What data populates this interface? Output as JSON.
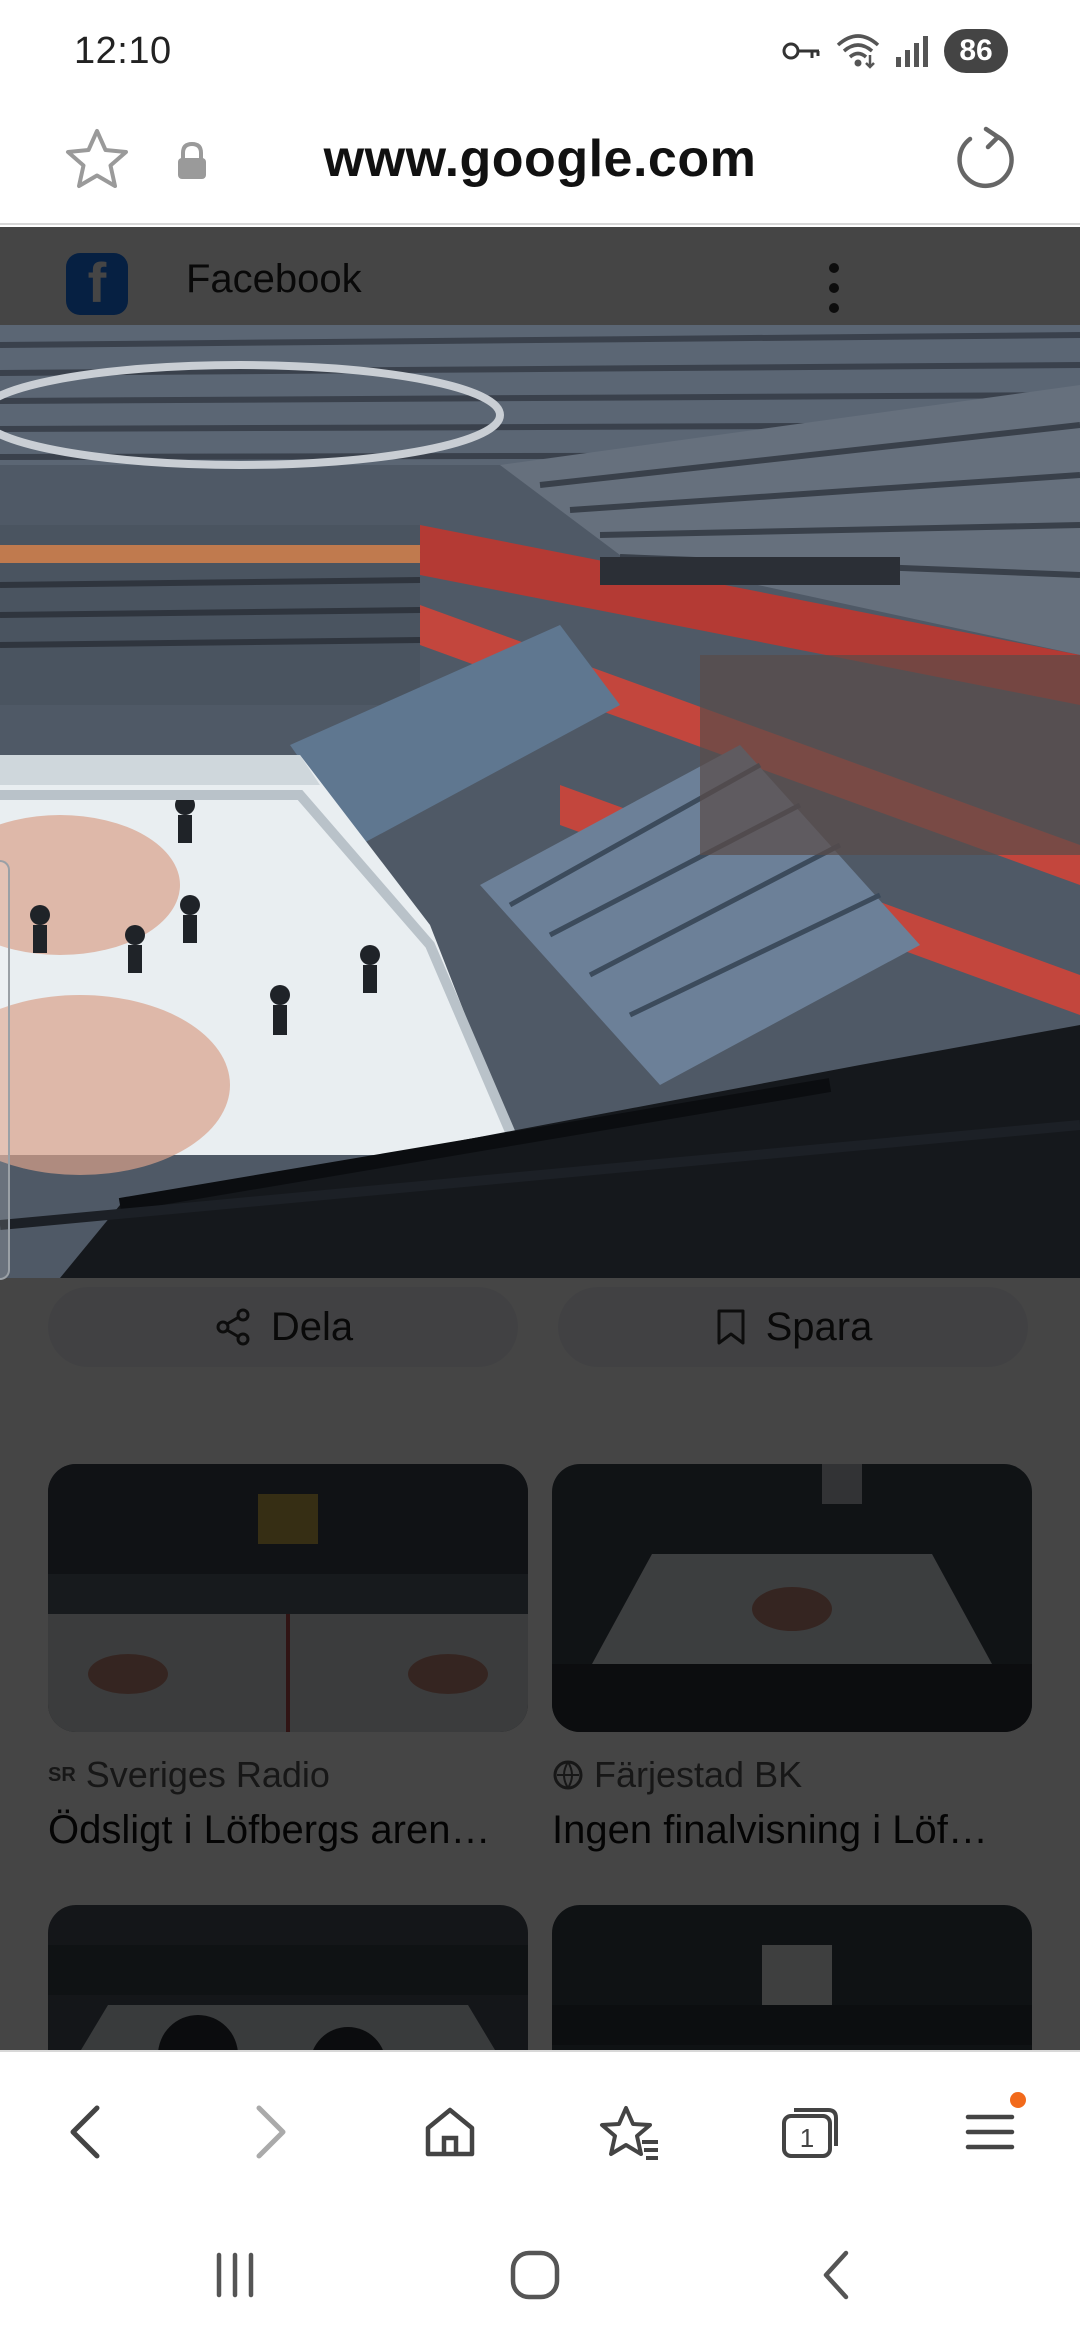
{
  "status_bar": {
    "time": "12:10",
    "battery": "86",
    "icons": [
      "vpn-key-icon",
      "wifi-icon",
      "signal-icon"
    ]
  },
  "address_bar": {
    "url": "www.google.com",
    "icons": [
      "star-outline-icon",
      "lock-icon",
      "reload-icon"
    ]
  },
  "image_preview": {
    "source_name": "Facebook",
    "source_icon": "facebook-logo",
    "image_description": "indoor ice hockey arena, view from upper stands over rink and seating",
    "actions": [
      {
        "label": "Dela",
        "icon": "share-icon"
      },
      {
        "label": "Spara",
        "icon": "bookmark-icon"
      }
    ]
  },
  "related_results": [
    {
      "source": "Sveriges Radio",
      "title": "Ödsligt i Löfbergs aren…"
    },
    {
      "source": "Färjestad BK",
      "title": "Ingen finalvisning i Löf…"
    },
    {
      "source": "",
      "title": ""
    },
    {
      "source": "",
      "title": ""
    }
  ],
  "browser_toolbar": {
    "buttons": [
      "back-icon",
      "forward-icon",
      "home-icon",
      "bookmarks-icon",
      "tabs-icon",
      "menu-icon"
    ],
    "tab_count": "1"
  },
  "system_nav": {
    "buttons": [
      "recents-icon",
      "home-icon",
      "back-icon"
    ]
  },
  "colors": {
    "overlay": "#000000",
    "accent_dot": "#f26a1b",
    "facebook_blue": "#1877f2",
    "badge_bg": "#444444"
  }
}
